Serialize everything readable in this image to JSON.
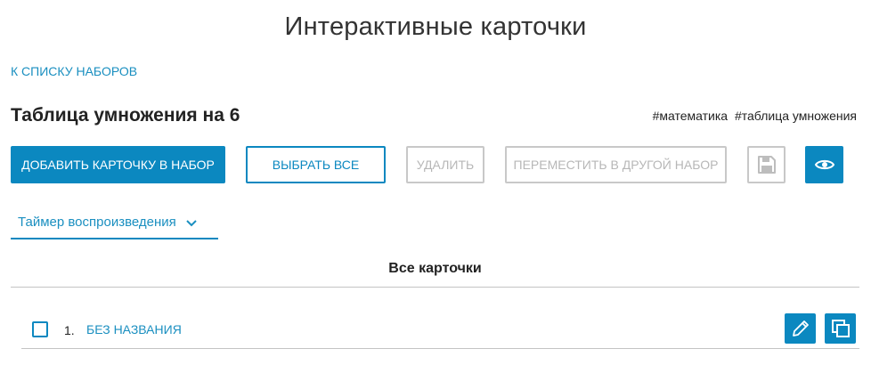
{
  "header": {
    "title": "Интерактивные карточки",
    "back_link": "К списку наборов"
  },
  "set": {
    "title": "Таблица умножения на 6",
    "tags": [
      "#математика",
      "#таблица умножения"
    ]
  },
  "toolbar": {
    "add_label": "Добавить карточку в набор",
    "select_all_label": "Выбрать все",
    "delete_label": "Удалить",
    "move_label": "Переместить в другой набор",
    "save_icon": "save-icon",
    "view_icon": "eye-icon"
  },
  "timer": {
    "label": "Таймер воспроизведения",
    "icon": "chevron-down-icon"
  },
  "cards": {
    "heading": "Все карточки",
    "items": [
      {
        "number": "1.",
        "title": "Без названия"
      }
    ]
  },
  "colors": {
    "accent": "#0b88c0",
    "disabled": "#b7b7b7"
  }
}
